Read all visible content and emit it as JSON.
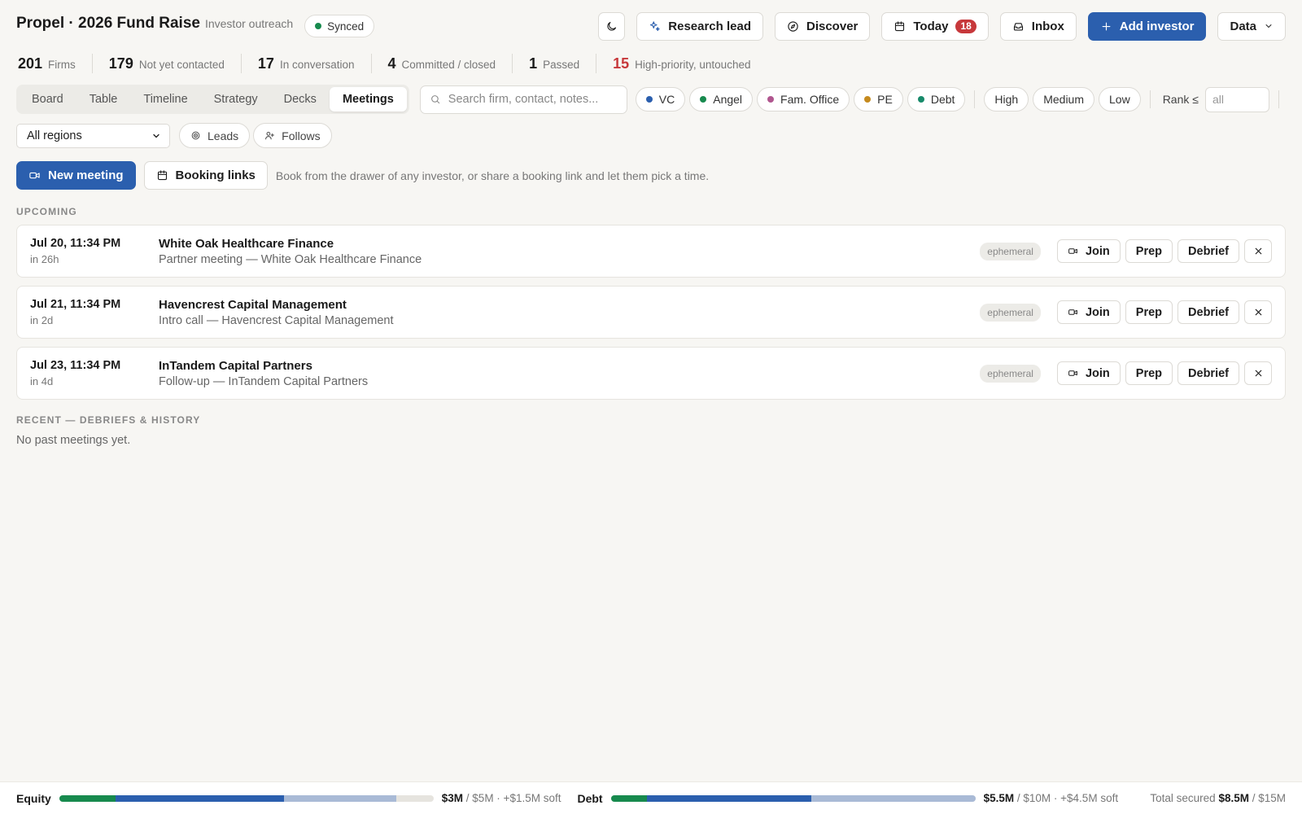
{
  "header": {
    "title": "Propel · 2026 Fund Raise",
    "subtitle": "Investor outreach",
    "sync_status": "Synced",
    "actions": {
      "research": "Research lead",
      "discover": "Discover",
      "today": "Today",
      "today_count": "18",
      "inbox": "Inbox",
      "add_investor": "Add investor",
      "data": "Data"
    }
  },
  "stats": [
    {
      "value": "201",
      "label": "Firms"
    },
    {
      "value": "179",
      "label": "Not yet contacted"
    },
    {
      "value": "17",
      "label": "In conversation"
    },
    {
      "value": "4",
      "label": "Committed / closed"
    },
    {
      "value": "1",
      "label": "Passed"
    },
    {
      "value": "15",
      "label": "High-priority, untouched"
    }
  ],
  "tabs": [
    "Board",
    "Table",
    "Timeline",
    "Strategy",
    "Decks",
    "Meetings"
  ],
  "active_tab": "Meetings",
  "search": {
    "placeholder": "Search firm, contact, notes..."
  },
  "type_filters": [
    {
      "label": "VC",
      "color": "#2b5fae"
    },
    {
      "label": "Angel",
      "color": "#178a4e"
    },
    {
      "label": "Fam. Office",
      "color": "#b0568f"
    },
    {
      "label": "PE",
      "color": "#c58a1e"
    },
    {
      "label": "Debt",
      "color": "#178a6a"
    }
  ],
  "priority_filters": [
    "High",
    "Medium",
    "Low"
  ],
  "rank": {
    "label": "Rank ≤",
    "placeholder": "all"
  },
  "region": "All regions",
  "toggles": {
    "leads": "Leads",
    "follows": "Follows"
  },
  "meetings_toolbar": {
    "new_meeting": "New meeting",
    "booking_links": "Booking links",
    "hint": "Book from the drawer of any investor, or share a booking link and let them pick a time."
  },
  "upcoming_label": "UPCOMING",
  "upcoming": [
    {
      "date": "Jul 20, 11:34 PM",
      "relative": "in 26h",
      "firm": "White Oak Healthcare Finance",
      "desc": "Partner meeting — White Oak Healthcare Finance",
      "tag": "ephemeral"
    },
    {
      "date": "Jul 21, 11:34 PM",
      "relative": "in 2d",
      "firm": "Havencrest Capital Management",
      "desc": "Intro call — Havencrest Capital Management",
      "tag": "ephemeral"
    },
    {
      "date": "Jul 23, 11:34 PM",
      "relative": "in 4d",
      "firm": "InTandem Capital Partners",
      "desc": "Follow-up — InTandem Capital Partners",
      "tag": "ephemeral"
    }
  ],
  "meeting_buttons": {
    "join": "Join",
    "prep": "Prep",
    "debrief": "Debrief"
  },
  "recent_label": "RECENT — DEBRIEFS & HISTORY",
  "recent_empty": "No past meetings yet.",
  "footer": {
    "equity": {
      "label": "Equity",
      "secured": "$3M",
      "target": " / $5M · +$1.5M soft",
      "committed_frac": 0.15,
      "closed_frac": 0.45,
      "soft_frac": 0.3
    },
    "debt": {
      "label": "Debt",
      "secured": "$5.5M",
      "target": " / $10M · +$4.5M soft",
      "committed_frac": 0.1,
      "closed_frac": 0.45,
      "soft_frac": 0.45
    },
    "total_label": "Total secured",
    "total_value": "$8.5M",
    "total_target": " / $15M"
  },
  "colors": {
    "accent": "#2b5fae",
    "alert": "#c7383b",
    "committed": "#178a4e",
    "closed": "#2b5fae",
    "soft": "#a9bad6",
    "synced": "#178a4e"
  }
}
